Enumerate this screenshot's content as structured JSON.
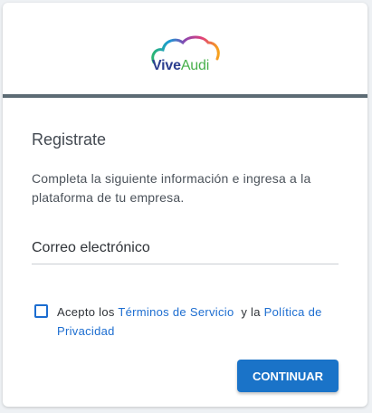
{
  "logo": {
    "part1": "Vive",
    "part2": "Audi",
    "icon": "cloud-rainbow-icon"
  },
  "form": {
    "title": "Registrate",
    "description": "Completa la siguiente información e ingresa a la plataforma de tu empresa.",
    "email_label": "Correo electrónico",
    "terms_prefix": "Acepto los ",
    "terms_link": "Términos de Servicio",
    "terms_middle": "  y la ",
    "privacy_link": "Política de Privacidad",
    "accepted": false,
    "submit_label": "CONTINUAR"
  },
  "colors": {
    "accent": "#1a73c8",
    "divider": "#5c6b74",
    "link": "#1c6dd0"
  }
}
